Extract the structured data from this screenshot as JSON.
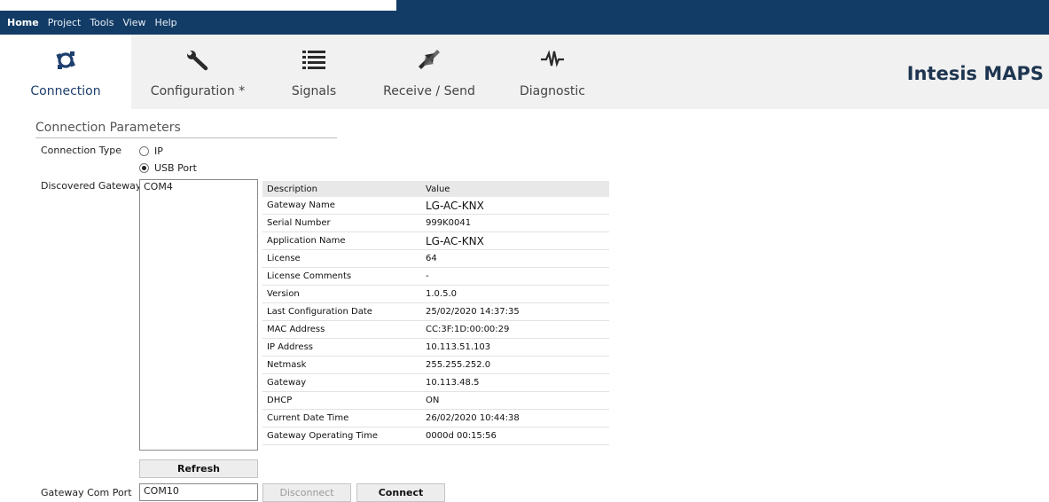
{
  "menu": [
    "Home",
    "Project",
    "Tools",
    "View",
    "Help"
  ],
  "ribbon": {
    "tabs": [
      {
        "label": "Connection",
        "icon": "connection-icon"
      },
      {
        "label": "Configuration *",
        "icon": "wrench-icon"
      },
      {
        "label": "Signals",
        "icon": "list-icon"
      },
      {
        "label": "Receive / Send",
        "icon": "transfer-icon"
      },
      {
        "label": "Diagnostic",
        "icon": "pulse-icon"
      }
    ],
    "active": "Connection",
    "brand": "Intesis MAPS"
  },
  "connection": {
    "section_title": "Connection Parameters",
    "type_label": "Connection Type",
    "options": [
      "IP",
      "USB Port"
    ],
    "selected": "USB Port",
    "gateways_label": "Discovered Gateways",
    "gateways": [
      "COM4"
    ],
    "refresh_label": "Refresh",
    "com_port_label": "Gateway Com Port",
    "com_port_value": "COM10",
    "disconnect_label": "Disconnect",
    "connect_label": "Connect"
  },
  "info_table": {
    "headers": [
      "Description",
      "Value"
    ],
    "rows": [
      [
        "Gateway Name",
        "LG-AC-KNX"
      ],
      [
        "Serial Number",
        "999K0041"
      ],
      [
        "Application Name",
        "LG-AC-KNX"
      ],
      [
        "License",
        "64"
      ],
      [
        "License Comments",
        "-"
      ],
      [
        "Version",
        "1.0.5.0"
      ],
      [
        "Last Configuration Date",
        "25/02/2020 14:37:35"
      ],
      [
        "MAC Address",
        "CC:3F:1D:00:00:29"
      ],
      [
        "IP Address",
        "10.113.51.103"
      ],
      [
        "Netmask",
        "255.255.252.0"
      ],
      [
        "Gateway",
        "10.113.48.5"
      ],
      [
        "DHCP",
        "ON"
      ],
      [
        "Current Date Time",
        "26/02/2020 10:44:38"
      ],
      [
        "Gateway Operating Time",
        "0000d 00:15:56"
      ]
    ]
  },
  "colors": {
    "menubar": "#123c66",
    "ribbon": "#f1f1f1",
    "brand": "#1d3550"
  }
}
